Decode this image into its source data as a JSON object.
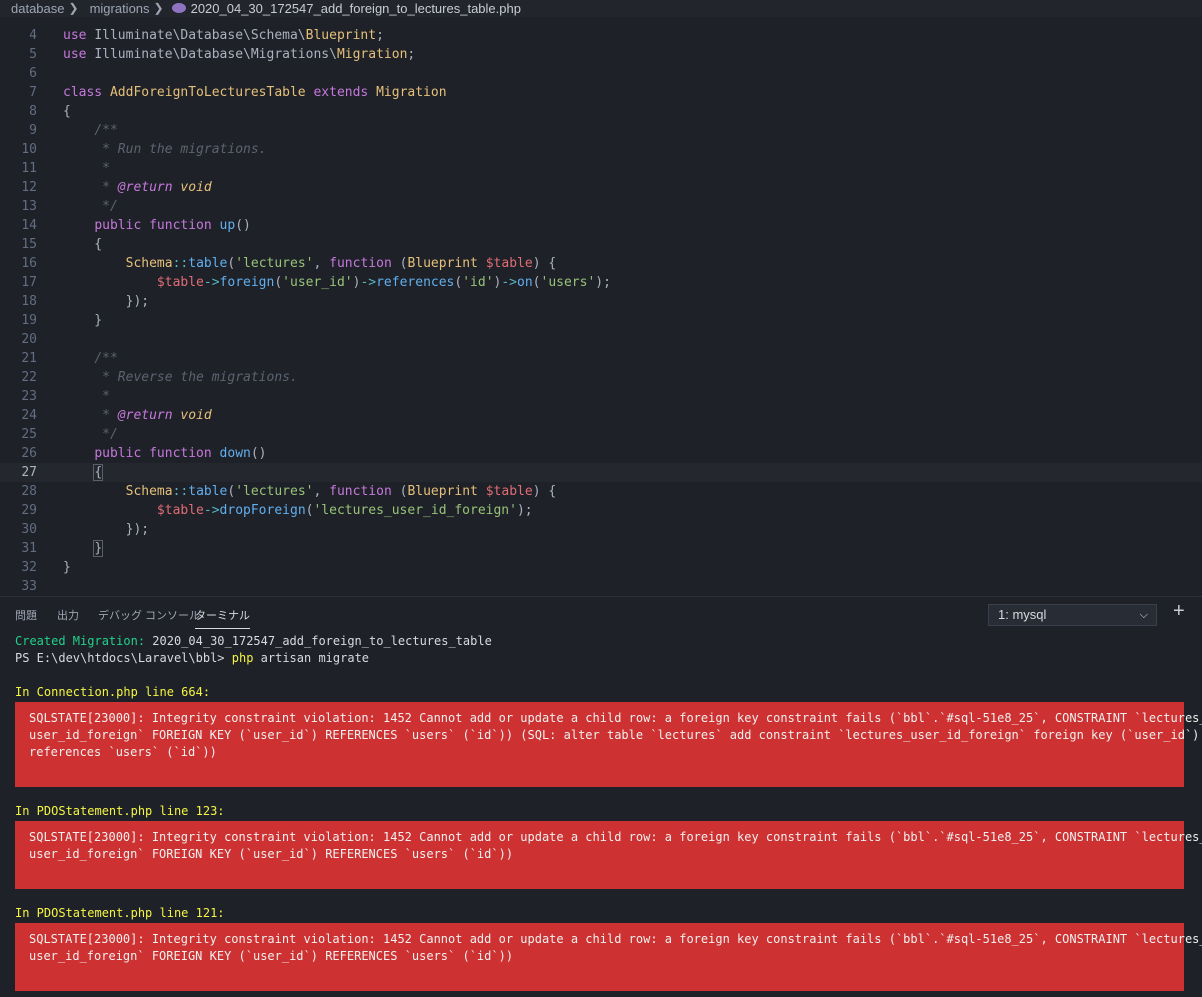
{
  "breadcrumb": {
    "items": [
      "database",
      "migrations"
    ],
    "separator": ">",
    "file": "2020_04_30_172547_add_foreign_to_lectures_table.php",
    "file_icon": "php-elephant-icon"
  },
  "editor": {
    "lines": [
      {
        "n": "4",
        "segs": [
          [
            "k",
            "use "
          ],
          [
            "p",
            "Illuminate\\Database\\Schema\\"
          ],
          [
            "cl",
            "Blueprint"
          ],
          [
            "p",
            ";"
          ]
        ]
      },
      {
        "n": "5",
        "segs": [
          [
            "k",
            "use "
          ],
          [
            "p",
            "Illuminate\\Database\\Migrations\\"
          ],
          [
            "cl",
            "Migration"
          ],
          [
            "p",
            ";"
          ]
        ]
      },
      {
        "n": "6",
        "segs": []
      },
      {
        "n": "7",
        "segs": [
          [
            "k",
            "class "
          ],
          [
            "cl",
            "AddForeignToLecturesTable "
          ],
          [
            "k",
            "extends "
          ],
          [
            "cl",
            "Migration"
          ]
        ]
      },
      {
        "n": "8",
        "segs": [
          [
            "p",
            "{"
          ]
        ]
      },
      {
        "n": "9",
        "segs": [
          [
            "p",
            "    "
          ],
          [
            "c",
            "/**"
          ]
        ]
      },
      {
        "n": "10",
        "segs": [
          [
            "p",
            "     "
          ],
          [
            "c",
            "* Run the migrations."
          ]
        ]
      },
      {
        "n": "11",
        "segs": [
          [
            "p",
            "     "
          ],
          [
            "c",
            "*"
          ]
        ]
      },
      {
        "n": "12",
        "segs": [
          [
            "p",
            "     "
          ],
          [
            "c",
            "* "
          ],
          [
            "ck",
            "@return "
          ],
          [
            "ct",
            "void"
          ]
        ]
      },
      {
        "n": "13",
        "segs": [
          [
            "p",
            "     "
          ],
          [
            "c",
            "*/"
          ]
        ]
      },
      {
        "n": "14",
        "segs": [
          [
            "p",
            "    "
          ],
          [
            "k",
            "public function "
          ],
          [
            "fn",
            "up"
          ],
          [
            "p",
            "()"
          ]
        ]
      },
      {
        "n": "15",
        "segs": [
          [
            "p",
            "    {"
          ]
        ]
      },
      {
        "n": "16",
        "segs": [
          [
            "p",
            "        "
          ],
          [
            "cl",
            "Schema"
          ],
          [
            "op",
            "::"
          ],
          [
            "fn",
            "table"
          ],
          [
            "p",
            "("
          ],
          [
            "s",
            "'lectures'"
          ],
          [
            "p",
            ", "
          ],
          [
            "k",
            "function "
          ],
          [
            "p",
            "("
          ],
          [
            "cl",
            "Blueprint "
          ],
          [
            "v",
            "$table"
          ],
          [
            "p",
            ") {"
          ]
        ]
      },
      {
        "n": "17",
        "segs": [
          [
            "p",
            "            "
          ],
          [
            "v",
            "$table"
          ],
          [
            "op",
            "->"
          ],
          [
            "fn",
            "foreign"
          ],
          [
            "p",
            "("
          ],
          [
            "s",
            "'user_id'"
          ],
          [
            "p",
            ")"
          ],
          [
            "op",
            "->"
          ],
          [
            "fn",
            "references"
          ],
          [
            "p",
            "("
          ],
          [
            "s",
            "'id'"
          ],
          [
            "p",
            ")"
          ],
          [
            "op",
            "->"
          ],
          [
            "fn",
            "on"
          ],
          [
            "p",
            "("
          ],
          [
            "s",
            "'users'"
          ],
          [
            "p",
            ");"
          ]
        ]
      },
      {
        "n": "18",
        "segs": [
          [
            "p",
            "        });"
          ]
        ]
      },
      {
        "n": "19",
        "segs": [
          [
            "p",
            "    }"
          ]
        ]
      },
      {
        "n": "20",
        "segs": []
      },
      {
        "n": "21",
        "segs": [
          [
            "p",
            "    "
          ],
          [
            "c",
            "/**"
          ]
        ]
      },
      {
        "n": "22",
        "segs": [
          [
            "p",
            "     "
          ],
          [
            "c",
            "* Reverse the migrations."
          ]
        ]
      },
      {
        "n": "23",
        "segs": [
          [
            "p",
            "     "
          ],
          [
            "c",
            "*"
          ]
        ]
      },
      {
        "n": "24",
        "segs": [
          [
            "p",
            "     "
          ],
          [
            "c",
            "* "
          ],
          [
            "ck",
            "@return "
          ],
          [
            "ct",
            "void"
          ]
        ]
      },
      {
        "n": "25",
        "segs": [
          [
            "p",
            "     "
          ],
          [
            "c",
            "*/"
          ]
        ]
      },
      {
        "n": "26",
        "segs": [
          [
            "p",
            "    "
          ],
          [
            "k",
            "public function "
          ],
          [
            "fn",
            "down"
          ],
          [
            "p",
            "()"
          ]
        ]
      },
      {
        "n": "27",
        "segs": [
          [
            "p",
            "    "
          ],
          [
            "br",
            "{"
          ]
        ],
        "current": true
      },
      {
        "n": "28",
        "segs": [
          [
            "p",
            "        "
          ],
          [
            "cl",
            "Schema"
          ],
          [
            "op",
            "::"
          ],
          [
            "fn",
            "table"
          ],
          [
            "p",
            "("
          ],
          [
            "s",
            "'lectures'"
          ],
          [
            "p",
            ", "
          ],
          [
            "k",
            "function "
          ],
          [
            "p",
            "("
          ],
          [
            "cl",
            "Blueprint "
          ],
          [
            "v",
            "$table"
          ],
          [
            "p",
            ") {"
          ]
        ]
      },
      {
        "n": "29",
        "segs": [
          [
            "p",
            "            "
          ],
          [
            "v",
            "$table"
          ],
          [
            "op",
            "->"
          ],
          [
            "fn",
            "dropForeign"
          ],
          [
            "p",
            "("
          ],
          [
            "s",
            "'lectures_user_id_foreign'"
          ],
          [
            "p",
            ");"
          ]
        ]
      },
      {
        "n": "30",
        "segs": [
          [
            "p",
            "        });"
          ]
        ]
      },
      {
        "n": "31",
        "segs": [
          [
            "p",
            "    "
          ],
          [
            "br",
            "}"
          ]
        ]
      },
      {
        "n": "32",
        "segs": [
          [
            "p",
            "}"
          ]
        ]
      },
      {
        "n": "33",
        "segs": []
      }
    ]
  },
  "panel": {
    "tabs": [
      {
        "label": "問題",
        "active": false
      },
      {
        "label": "出力",
        "active": false
      },
      {
        "label": "デバッグ コンソール",
        "active": false
      },
      {
        "label": "ターミナル",
        "active": true
      }
    ],
    "terminal_select": "1: mysql",
    "new_terminal_icon": "plus-icon"
  },
  "terminal": {
    "created_label": "Created Migration:",
    "created_value": " 2020_04_30_172547_add_foreign_to_lectures_table",
    "prompt": "PS E:\\dev\\htdocs\\Laravel\\bbl> ",
    "command_name": "php",
    "command_args": " artisan migrate",
    "errors": [
      {
        "header": "In Connection.php line 664:",
        "message": "SQLSTATE[23000]: Integrity constraint violation: 1452 Cannot add or update a child row: a foreign key constraint fails (`bbl`.`#sql-51e8_25`, CONSTRAINT `lectures_\nuser_id_foreign` FOREIGN KEY (`user_id`) REFERENCES `users` (`id`)) (SQL: alter table `lectures` add constraint `lectures_user_id_foreign` foreign key (`user_id`)\nreferences `users` (`id`))"
      },
      {
        "header": "In PDOStatement.php line 123:",
        "message": "SQLSTATE[23000]: Integrity constraint violation: 1452 Cannot add or update a child row: a foreign key constraint fails (`bbl`.`#sql-51e8_25`, CONSTRAINT `lectures_\nuser_id_foreign` FOREIGN KEY (`user_id`) REFERENCES `users` (`id`))"
      },
      {
        "header": "In PDOStatement.php line 121:",
        "message": "SQLSTATE[23000]: Integrity constraint violation: 1452 Cannot add or update a child row: a foreign key constraint fails (`bbl`.`#sql-51e8_25`, CONSTRAINT `lectures_\nuser_id_foreign` FOREIGN KEY (`user_id`) REFERENCES `users` (`id`))"
      }
    ]
  },
  "colors": {
    "background": "#1e2127",
    "error_block": "#cd3131",
    "success_text": "#23d18b",
    "header_text": "#f5f543"
  }
}
